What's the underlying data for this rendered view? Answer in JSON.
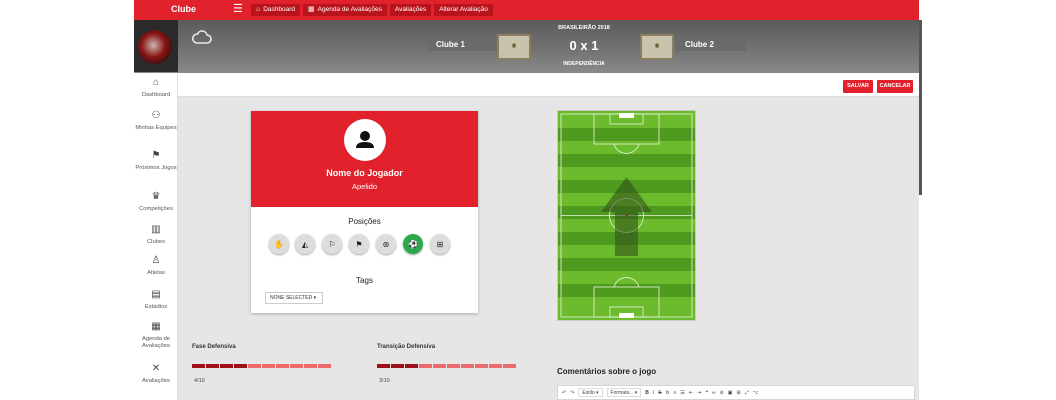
{
  "app": {
    "title": "Clube"
  },
  "breadcrumbs": [
    {
      "label": "Dashboard",
      "icon": "home-icon"
    },
    {
      "label": "Agenda de Avaliações",
      "icon": "calendar-icon"
    },
    {
      "label": "Avaliações"
    },
    {
      "label": "Alterar Avaliação"
    }
  ],
  "match": {
    "competition": "BRASILEIRÃO 2018",
    "home_team": "Clube 1",
    "away_team": "Clube 2",
    "score": "0 x 1",
    "stadium": "INDEPENDÊNCIA"
  },
  "sidebar": {
    "items": [
      {
        "label": "Dashboard",
        "icon": "home-icon"
      },
      {
        "label": "Minhas Equipes",
        "icon": "teams-icon"
      },
      {
        "label": "Próximos Jogos",
        "icon": "flag-icon"
      },
      {
        "label": "Competições",
        "icon": "trophy-icon"
      },
      {
        "label": "Clubes",
        "icon": "building-icon"
      },
      {
        "label": "Atletas",
        "icon": "person-icon"
      },
      {
        "label": "Estádios",
        "icon": "stadium-icon"
      },
      {
        "label": "Agenda de Avaliações",
        "icon": "calendar-icon"
      },
      {
        "label": "Avaliações",
        "icon": "tools-icon"
      }
    ]
  },
  "actions": {
    "save": "SALVAR",
    "cancel": "CANCELAR"
  },
  "player": {
    "name": "Nome do Jogador",
    "nickname": "Apelido",
    "positions_title": "Posições",
    "positions": [
      {
        "icon": "goalkeeper-gloves-icon",
        "active": false
      },
      {
        "icon": "defender-icon",
        "active": false
      },
      {
        "icon": "corner-flag-left-icon",
        "active": false
      },
      {
        "icon": "corner-flag-right-icon",
        "active": false
      },
      {
        "icon": "steering-wheel-icon",
        "active": false
      },
      {
        "icon": "soccer-ball-icon",
        "active": true
      },
      {
        "icon": "goal-icon",
        "active": false
      }
    ],
    "tags_title": "Tags",
    "tags_select": "NONE SELECTED"
  },
  "phases": [
    {
      "label": "Fase Defensiva",
      "value": "4/10",
      "score": 4,
      "max": 10
    },
    {
      "label": "Transição Defensiva",
      "value": "3/10",
      "score": 3,
      "max": 10
    }
  ],
  "comments": {
    "title": "Comentários sobre o jogo",
    "style_select": "Estilo",
    "format_select": "Formata..."
  },
  "colors": {
    "accent": "#e1212b",
    "dark_accent": "#a01019",
    "pitch_light": "#6bbb2c",
    "pitch_dark": "#4e9a1f"
  }
}
